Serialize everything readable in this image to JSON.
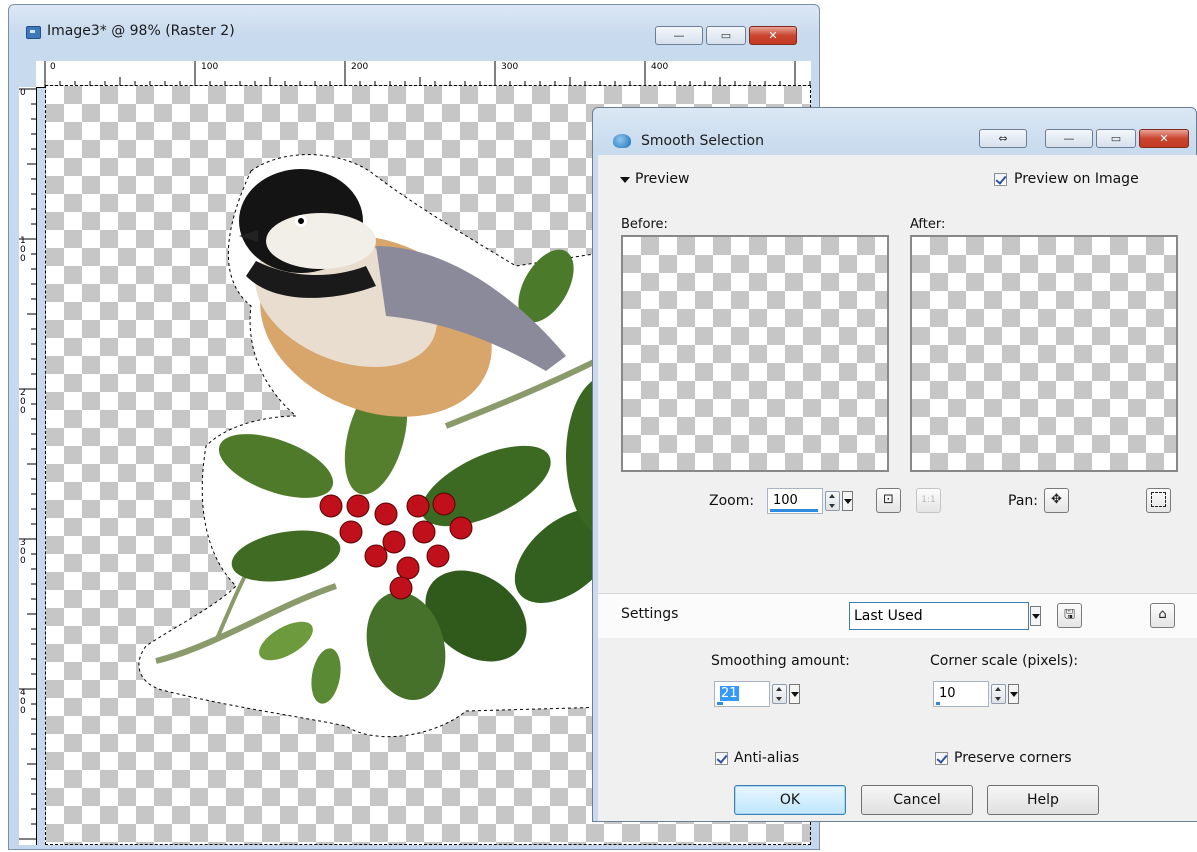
{
  "document_window": {
    "title": "Image3* @  98% (Raster 2)",
    "buttons": {
      "minimize": "—",
      "maximize": "▭",
      "close": "✕"
    },
    "ruler_top_labels": [
      "0",
      "100",
      "200",
      "300",
      "400"
    ],
    "ruler_left_labels": [
      "0",
      "100",
      "200",
      "300",
      "400"
    ]
  },
  "dialog": {
    "title": "Smooth Selection",
    "title_buttons": {
      "swap": "⇔",
      "minimize": "—",
      "maximize": "▭",
      "close": "✕"
    },
    "preview_section": {
      "label": "Preview",
      "preview_on_image_label": "Preview on Image",
      "preview_on_image_checked": true,
      "before_label": "Before:",
      "after_label": "After:",
      "zoom_label": "Zoom:",
      "zoom_value": "100",
      "pan_label": "Pan:"
    },
    "settings": {
      "label": "Settings",
      "preset_value": "Last Used"
    },
    "smoothing_amount_label": "Smoothing amount:",
    "smoothing_amount_value": "21",
    "corner_scale_label": "Corner scale (pixels):",
    "corner_scale_value": "10",
    "anti_alias_label": "Anti-alias",
    "anti_alias_checked": true,
    "preserve_corners_label": "Preserve corners",
    "preserve_corners_checked": true,
    "buttons": {
      "ok": "OK",
      "cancel": "Cancel",
      "help": "Help"
    }
  },
  "colors": {
    "accent_blue": "#2f8ae2",
    "checker_gray": "#c6c6c6",
    "close_red": "#c43a23",
    "leaf_green": "#3f6b23",
    "berry_red": "#c0101b"
  },
  "icons": [
    "app-document-icon",
    "smooth-selection-icon",
    "swap-icon",
    "zoom-fit-icon",
    "zoom-1to1-icon",
    "pan-icon",
    "marquee-icon",
    "save-preset-icon",
    "reset-icon"
  ]
}
